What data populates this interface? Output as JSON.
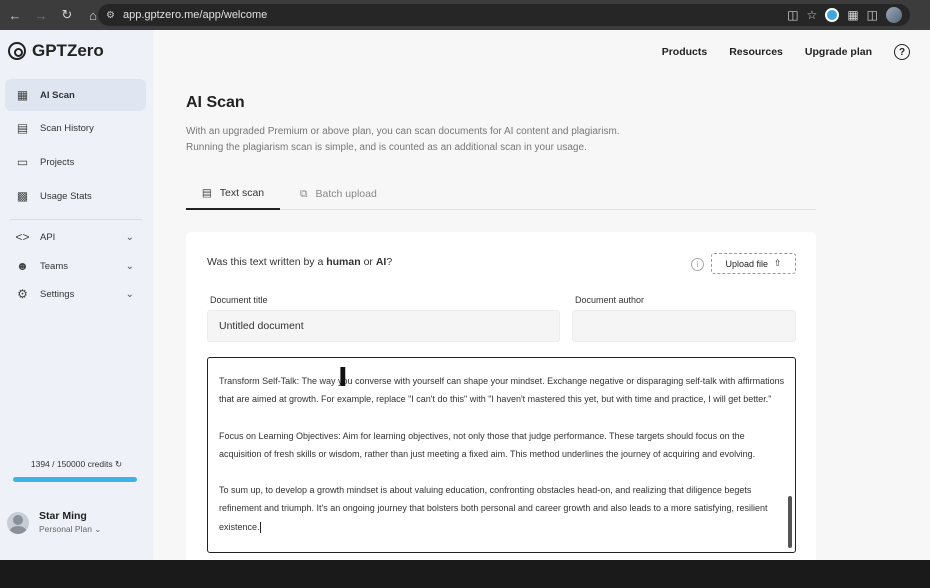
{
  "browser": {
    "url": "app.gptzero.me/app/welcome"
  },
  "app": {
    "logo_text": "GPTZero"
  },
  "sidebar": {
    "items": [
      {
        "label": "AI Scan",
        "icon": "grid-icon"
      },
      {
        "label": "Scan History",
        "icon": "document-icon"
      },
      {
        "label": "Projects",
        "icon": "folder-icon"
      },
      {
        "label": "Usage Stats",
        "icon": "bar-chart-icon"
      },
      {
        "label": "API",
        "icon": "code-icon"
      },
      {
        "label": "Teams",
        "icon": "team-icon"
      },
      {
        "label": "Settings",
        "icon": "gear-icon"
      }
    ],
    "credits": "1394 / 150000 credits",
    "user_name": "Star Ming",
    "user_plan": "Personal Plan"
  },
  "topnav": {
    "products": "Products",
    "resources": "Resources",
    "upgrade": "Upgrade plan",
    "help": "?"
  },
  "main": {
    "title": "AI Scan",
    "desc_line1": "With an upgraded Premium or above plan, you can scan documents for AI content and plagiarism.",
    "desc_line2": "Running the plagiarism scan is simple, and is counted as an additional scan in your usage.",
    "tabs": [
      {
        "label": "Text scan"
      },
      {
        "label": "Batch upload"
      }
    ],
    "question_pre": "Was this text written by a ",
    "question_human": "human",
    "question_mid": " or ",
    "question_ai": "AI",
    "question_post": "?",
    "upload_label": "Upload file",
    "doc_title_label": "Document title",
    "doc_title_value": "Untitled document",
    "doc_author_label": "Document author",
    "doc_author_value": "",
    "paragraphs": [
      "Transform Self-Talk: The way you converse with yourself can shape your mindset. Exchange negative or disparaging self-talk with affirmations that are aimed at growth. For example, replace \"I can't do this\" with \"I haven't mastered this yet, but with time and practice, I will get better.\"",
      "Focus on Learning Objectives: Aim for learning objectives, not only those that judge performance. These targets should focus on the acquisition of fresh skills or wisdom, rather than just meeting a fixed aim. This method underlines the journey of acquiring and evolving.",
      "To sum up, to develop a growth mindset is about valuing education, confronting obstacles head-on, and realizing that diligence begets refinement and triumph. It's an ongoing journey that bolsters both personal and career growth and also leads to a more satisfying, resilient existence."
    ]
  }
}
